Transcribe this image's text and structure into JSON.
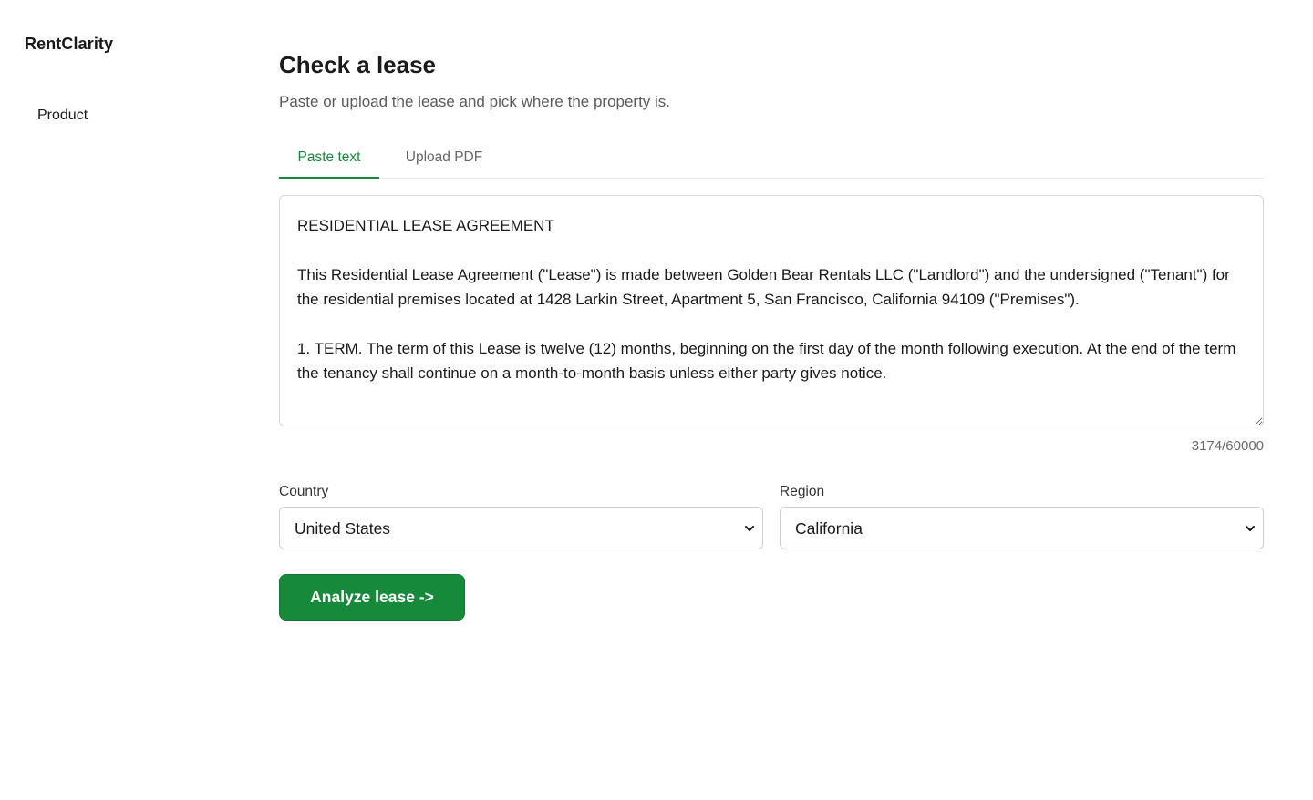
{
  "sidebar": {
    "brand": "RentClarity",
    "items": [
      {
        "label": "Product"
      }
    ]
  },
  "main": {
    "title": "Check a lease",
    "subtitle": "Paste or upload the lease and pick where the property is.",
    "tabs": [
      {
        "label": "Paste text",
        "active": true
      },
      {
        "label": "Upload PDF",
        "active": false
      }
    ],
    "lease_text": "RESIDENTIAL LEASE AGREEMENT\n\nThis Residential Lease Agreement (\"Lease\") is made between Golden Bear Rentals LLC (\"Landlord\") and the undersigned (\"Tenant\") for the residential premises located at 1428 Larkin Street, Apartment 5, San Francisco, California 94109 (\"Premises\").\n\n1. TERM. The term of this Lease is twelve (12) months, beginning on the first day of the month following execution. At the end of the term the tenancy shall continue on a month-to-month basis unless either party gives notice.",
    "char_count": "3174/60000",
    "country": {
      "label": "Country",
      "value": "United States"
    },
    "region": {
      "label": "Region",
      "value": "California"
    },
    "analyze_label": "Analyze lease  ->"
  },
  "colors": {
    "accent": "#17873b",
    "button": "#17893a"
  },
  "icons": {
    "select_chevron": "chevron-down-icon"
  }
}
